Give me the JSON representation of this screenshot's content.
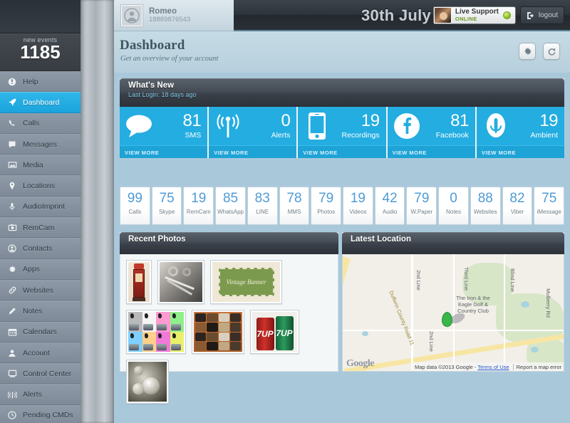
{
  "sidebar": {
    "events_label": "new events",
    "events_count": "1185",
    "items": [
      {
        "label": "Help",
        "icon": "info-icon",
        "active": false
      },
      {
        "label": "Dashboard",
        "icon": "rocket-icon",
        "active": true
      },
      {
        "label": "Calls",
        "icon": "phone-icon",
        "active": false
      },
      {
        "label": "Messages",
        "icon": "speech-bubble-icon",
        "active": false
      },
      {
        "label": "Media",
        "icon": "image-icon",
        "active": false
      },
      {
        "label": "Locations",
        "icon": "map-pin-icon",
        "active": false
      },
      {
        "label": "AudioImprint",
        "icon": "microphone-icon",
        "active": false
      },
      {
        "label": "RemCam",
        "icon": "camera-icon",
        "active": false
      },
      {
        "label": "Contacts",
        "icon": "contact-icon",
        "active": false
      },
      {
        "label": "Apps",
        "icon": "gear-icon",
        "active": false
      },
      {
        "label": "Websites",
        "icon": "link-icon",
        "active": false
      },
      {
        "label": "Notes",
        "icon": "pencil-icon",
        "active": false
      },
      {
        "label": "Calendars",
        "icon": "calendar-icon",
        "active": false
      },
      {
        "label": "Account",
        "icon": "person-icon",
        "active": false
      },
      {
        "label": "Control Center",
        "icon": "monitor-icon",
        "active": false
      },
      {
        "label": "Alerts",
        "icon": "signal-icon",
        "active": false
      },
      {
        "label": "Pending CMDs",
        "icon": "clock-icon",
        "active": false
      }
    ]
  },
  "header": {
    "user_name": "Romeo",
    "user_phone": "18889876543",
    "date": "30th July",
    "support_label": "Live Support",
    "support_status": "ONLINE",
    "logout_label": "logout"
  },
  "page": {
    "title": "Dashboard",
    "subtitle": "Get an overview of your account",
    "gear_button": "settings",
    "refresh_button": "refresh"
  },
  "whats_new": {
    "title": "What's New",
    "subtitle": "Last Login: 18 days ago",
    "view_more": "VIEW MORE",
    "tiles": [
      {
        "icon": "speech-bubble-icon",
        "value": "81",
        "label": "SMS"
      },
      {
        "icon": "broadcast-icon",
        "value": "0",
        "label": "Alerts"
      },
      {
        "icon": "phone-device-icon",
        "value": "19",
        "label": "Recordings"
      },
      {
        "icon": "facebook-icon",
        "value": "81",
        "label": "Facebook"
      },
      {
        "icon": "microphone-icon",
        "value": "19",
        "label": "Ambient"
      }
    ]
  },
  "counters": [
    {
      "value": "99",
      "label": "Calls"
    },
    {
      "value": "75",
      "label": "Skype"
    },
    {
      "value": "19",
      "label": "RemCam"
    },
    {
      "value": "85",
      "label": "WhatsApp"
    },
    {
      "value": "83",
      "label": "LINE"
    },
    {
      "value": "78",
      "label": "MMS"
    },
    {
      "value": "79",
      "label": "Photos"
    },
    {
      "value": "19",
      "label": "Videos"
    },
    {
      "value": "42",
      "label": "Audio"
    },
    {
      "value": "79",
      "label": "W.Paper"
    },
    {
      "value": "0",
      "label": "Notes"
    },
    {
      "value": "88",
      "label": "Websites"
    },
    {
      "value": "82",
      "label": "Viber"
    },
    {
      "value": "75",
      "label": "iMessage"
    }
  ],
  "recent_photos": {
    "title": "Recent Photos",
    "items": [
      {
        "name": "vintage-gas-pump-photo"
      },
      {
        "name": "black-white-tools-photo"
      },
      {
        "name": "vintage-banner-photo",
        "caption": "Vintage Banner"
      },
      {
        "name": "pop-art-grid-photo"
      },
      {
        "name": "hats-collection-photo"
      },
      {
        "name": "7up-cans-photo",
        "caption": "7UP"
      },
      {
        "name": "silver-ornaments-photo"
      }
    ]
  },
  "latest_location": {
    "title": "Latest Location",
    "place_label": "The Iron & the\nEagle Golf &\nCountry Club",
    "road_labels": [
      "Dufferin County Road 11",
      "2nd Line",
      "2nd Line",
      "Third Line",
      "Blind Line",
      "Mulberry Rd"
    ],
    "google_logo": "Google",
    "attribution": "Map data ©2013 Google -",
    "terms": "Terms of Use",
    "report": "Report a map error"
  }
}
